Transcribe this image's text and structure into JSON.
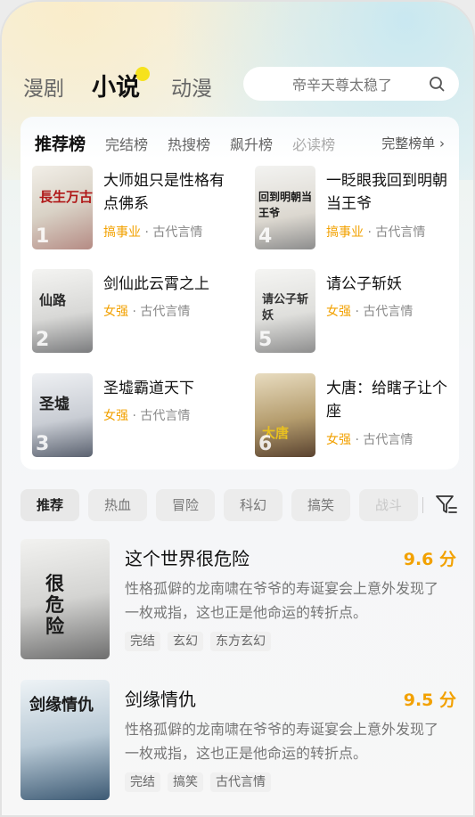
{
  "top_tabs": [
    {
      "label": "漫剧"
    },
    {
      "label": "小说"
    },
    {
      "label": "动漫"
    }
  ],
  "search": {
    "placeholder": "帝辛天尊太稳了"
  },
  "rank": {
    "tabs": [
      "推荐榜",
      "完结榜",
      "热搜榜",
      "飙升榜",
      "必读榜"
    ],
    "more_label": "完整榜单 ›",
    "books": [
      {
        "rank": "1",
        "title": "大师姐只是性格有点佛系",
        "tag": "搞事业",
        "genre": "古代言情",
        "cover_text": "長生万古"
      },
      {
        "rank": "4",
        "title": "一眨眼我回到明朝当王爷",
        "tag": "搞事业",
        "genre": "古代言情",
        "cover_text": "回到明朝当王爷"
      },
      {
        "rank": "2",
        "title": "剑仙此云霄之上",
        "tag": "女强",
        "genre": "古代言情",
        "cover_text": "仙路"
      },
      {
        "rank": "5",
        "title": "请公子斩妖",
        "tag": "女强",
        "genre": "古代言情",
        "cover_text": "请公子斩妖"
      },
      {
        "rank": "3",
        "title": "圣墟霸道天下",
        "tag": "女强",
        "genre": "古代言情",
        "cover_text": "圣墟"
      },
      {
        "rank": "6",
        "title": "大唐：给瞎子让个座",
        "tag": "女强",
        "genre": "古代言情",
        "cover_text": "大唐"
      }
    ]
  },
  "chips": [
    "推荐",
    "热血",
    "冒险",
    "科幻",
    "搞笑",
    "战斗"
  ],
  "list": [
    {
      "title": "这个世界很危险",
      "score": "9.6 分",
      "desc": "性格孤僻的龙南啸在爷爷的寿诞宴会上意外发现了一枚戒指，这也正是他命运的转折点。",
      "tags": [
        "完结",
        "玄幻",
        "东方玄幻"
      ],
      "cover_text": "很危险"
    },
    {
      "title": "剑缘情仇",
      "score": "9.5 分",
      "desc": "性格孤僻的龙南啸在爷爷的寿诞宴会上意外发现了一枚戒指，这也正是他命运的转折点。",
      "tags": [
        "完结",
        "搞笑",
        "古代言情"
      ],
      "cover_text": "剑缘情仇"
    }
  ],
  "colors": {
    "accent": "#f2a100",
    "dot": "#f6e21d"
  }
}
